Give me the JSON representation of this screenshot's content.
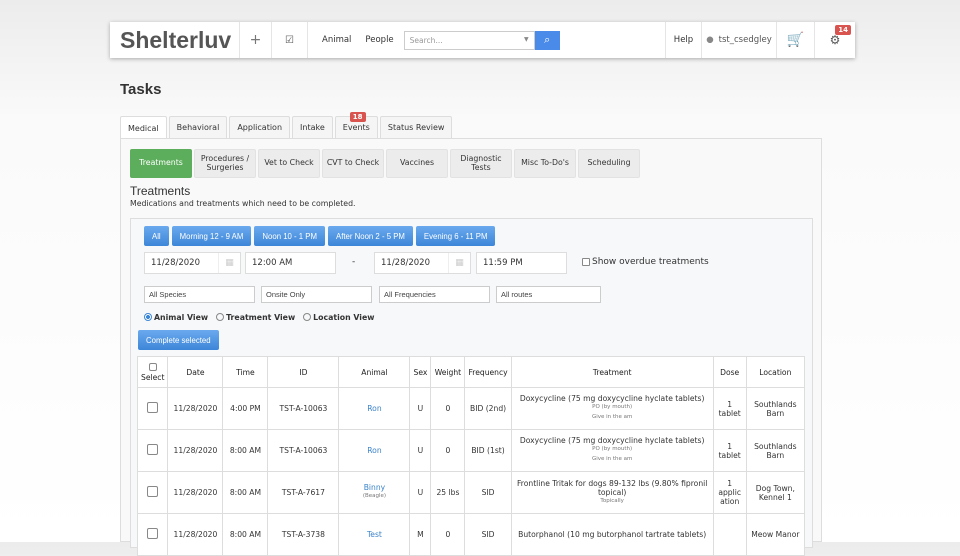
{
  "nav": {
    "logo": "Shelterluv",
    "add": "+",
    "tasks": "☑",
    "animal": "Animal",
    "people": "People",
    "search_placeholder": "Search...",
    "help": "Help",
    "user": "tst_csedgley",
    "settings_badge": "14"
  },
  "page": {
    "title": "Tasks"
  },
  "tabs": [
    {
      "label": "Medical"
    },
    {
      "label": "Behavioral"
    },
    {
      "label": "Application"
    },
    {
      "label": "Intake"
    },
    {
      "label": "Events",
      "badge": "18"
    },
    {
      "label": "Status Review"
    }
  ],
  "subtabs": [
    "Treatments",
    "Procedures / Surgeries",
    "Vet to Check",
    "CVT to Check",
    "Vaccines",
    "Diagnostic Tests",
    "Misc To-Do's",
    "Scheduling"
  ],
  "section": {
    "title": "Treatments",
    "desc": "Medications and treatments which need to be completed."
  },
  "time_buttons": [
    "All",
    "Morning 12 - 9 AM",
    "Noon 10 - 1 PM",
    "After Noon 2 - 5 PM",
    "Evening 6 - 11 PM"
  ],
  "range": {
    "start_date": "11/28/2020",
    "start_time": "12:00 AM",
    "sep": "-",
    "end_date": "11/28/2020",
    "end_time": "11:59 PM",
    "overdue_label": "Show overdue treatments"
  },
  "filters": [
    "All Species",
    "Onsite Only",
    "All Frequencies",
    "All routes"
  ],
  "views": [
    "Animal View",
    "Treatment View",
    "Location View"
  ],
  "complete_label": "Complete selected",
  "table": {
    "headers": [
      "Select",
      "Date",
      "Time",
      "ID",
      "Animal",
      "Sex",
      "Weight",
      "Frequency",
      "Treatment",
      "Dose",
      "Location"
    ],
    "rows": [
      {
        "date": "11/28/2020",
        "time": "4:00 PM",
        "id": "TST-A-10063",
        "animal": "Ron",
        "breed": "",
        "sex": "U",
        "weight": "0",
        "freq": "BID (2nd)",
        "treatment": "Doxycycline (75 mg doxycycline hyclate tablets)",
        "route": "PO (by mouth)",
        "note": "Give in the am",
        "dose": "1 tablet",
        "location": "Southlands Barn"
      },
      {
        "date": "11/28/2020",
        "time": "8:00 AM",
        "id": "TST-A-10063",
        "animal": "Ron",
        "breed": "",
        "sex": "U",
        "weight": "0",
        "freq": "BID (1st)",
        "treatment": "Doxycycline (75 mg doxycycline hyclate tablets)",
        "route": "PO (by mouth)",
        "note": "Give in the am",
        "dose": "1 tablet",
        "location": "Southlands Barn"
      },
      {
        "date": "11/28/2020",
        "time": "8:00 AM",
        "id": "TST-A-7617",
        "animal": "Binny",
        "breed": "(Beagle)",
        "sex": "U",
        "weight": "25 lbs",
        "freq": "SID",
        "treatment": "Frontline Tritak for dogs 89-132 lbs (9.80% fipronil topical)",
        "route": "Topically",
        "note": "",
        "dose": "1 applic ation",
        "location": "Dog Town, Kennel 1"
      },
      {
        "date": "11/28/2020",
        "time": "8:00 AM",
        "id": "TST-A-3738",
        "animal": "Test",
        "breed": "",
        "sex": "M",
        "weight": "0",
        "freq": "SID",
        "treatment": "Butorphanol (10 mg butorphanol tartrate tablets)",
        "route": "",
        "note": "",
        "dose": "",
        "location": "Meow Manor"
      }
    ]
  }
}
